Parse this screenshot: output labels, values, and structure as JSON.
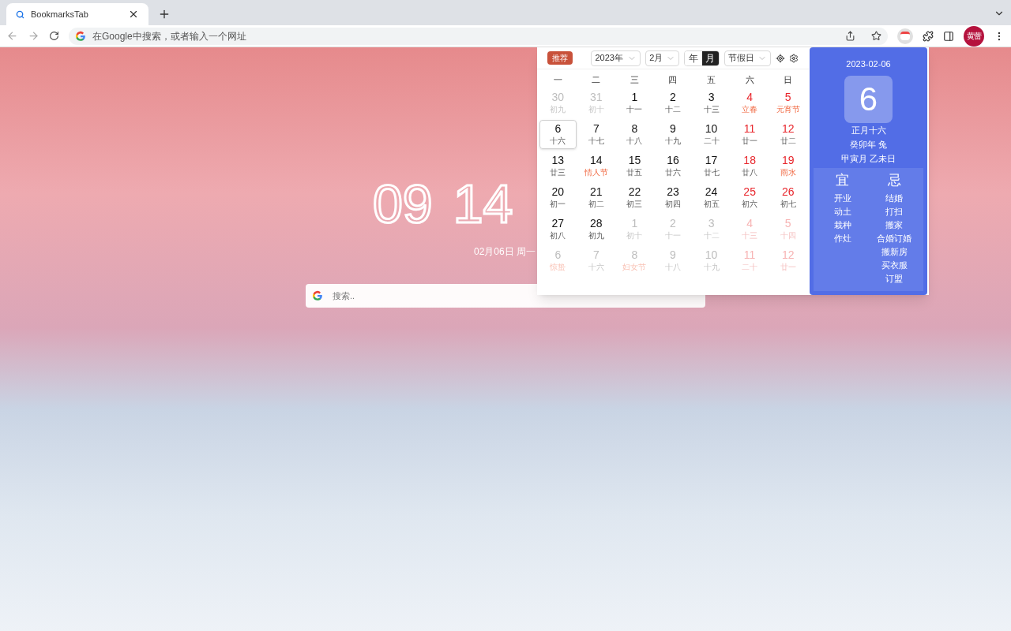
{
  "browser": {
    "tabs": [
      {
        "title": "BookmarksTab",
        "selected": true
      }
    ],
    "address": {
      "placeholder": "在Google中搜索，或者输入一个网址"
    },
    "profile": {
      "initials": "黄蕾"
    }
  },
  "clock": {
    "hours": "09",
    "minutes": "14",
    "date": "02月06日 周一"
  },
  "search": {
    "placeholder": "搜索.."
  },
  "calendar": {
    "badge": "推荐",
    "year_select": "2023年",
    "month_select": "2月",
    "view_toggle": [
      {
        "label": "年",
        "selected": false
      },
      {
        "label": "月",
        "selected": true
      }
    ],
    "filter_select": "节假日",
    "weekdays": [
      "一",
      "二",
      "三",
      "四",
      "五",
      "六",
      "日"
    ],
    "days": [
      {
        "day": "30",
        "sub": "初九",
        "muted": true,
        "red": false,
        "festival": false,
        "selected": false
      },
      {
        "day": "31",
        "sub": "初十",
        "muted": true,
        "red": false,
        "festival": false,
        "selected": false
      },
      {
        "day": "1",
        "sub": "十一",
        "muted": false,
        "red": false,
        "festival": false,
        "selected": false
      },
      {
        "day": "2",
        "sub": "十二",
        "muted": false,
        "red": false,
        "festival": false,
        "selected": false
      },
      {
        "day": "3",
        "sub": "十三",
        "muted": false,
        "red": false,
        "festival": false,
        "selected": false
      },
      {
        "day": "4",
        "sub": "立春",
        "muted": false,
        "red": true,
        "festival": true,
        "selected": false
      },
      {
        "day": "5",
        "sub": "元宵节",
        "muted": false,
        "red": true,
        "festival": true,
        "selected": false
      },
      {
        "day": "6",
        "sub": "十六",
        "muted": false,
        "red": false,
        "festival": false,
        "selected": true
      },
      {
        "day": "7",
        "sub": "十七",
        "muted": false,
        "red": false,
        "festival": false,
        "selected": false
      },
      {
        "day": "8",
        "sub": "十八",
        "muted": false,
        "red": false,
        "festival": false,
        "selected": false
      },
      {
        "day": "9",
        "sub": "十九",
        "muted": false,
        "red": false,
        "festival": false,
        "selected": false
      },
      {
        "day": "10",
        "sub": "二十",
        "muted": false,
        "red": false,
        "festival": false,
        "selected": false
      },
      {
        "day": "11",
        "sub": "廿一",
        "muted": false,
        "red": true,
        "festival": false,
        "selected": false
      },
      {
        "day": "12",
        "sub": "廿二",
        "muted": false,
        "red": true,
        "festival": false,
        "selected": false
      },
      {
        "day": "13",
        "sub": "廿三",
        "muted": false,
        "red": false,
        "festival": false,
        "selected": false
      },
      {
        "day": "14",
        "sub": "情人节",
        "muted": false,
        "red": false,
        "festival": true,
        "selected": false
      },
      {
        "day": "15",
        "sub": "廿五",
        "muted": false,
        "red": false,
        "festival": false,
        "selected": false
      },
      {
        "day": "16",
        "sub": "廿六",
        "muted": false,
        "red": false,
        "festival": false,
        "selected": false
      },
      {
        "day": "17",
        "sub": "廿七",
        "muted": false,
        "red": false,
        "festival": false,
        "selected": false
      },
      {
        "day": "18",
        "sub": "廿八",
        "muted": false,
        "red": true,
        "festival": false,
        "selected": false
      },
      {
        "day": "19",
        "sub": "雨水",
        "muted": false,
        "red": true,
        "festival": true,
        "selected": false
      },
      {
        "day": "20",
        "sub": "初一",
        "muted": false,
        "red": false,
        "festival": false,
        "selected": false
      },
      {
        "day": "21",
        "sub": "初二",
        "muted": false,
        "red": false,
        "festival": false,
        "selected": false
      },
      {
        "day": "22",
        "sub": "初三",
        "muted": false,
        "red": false,
        "festival": false,
        "selected": false
      },
      {
        "day": "23",
        "sub": "初四",
        "muted": false,
        "red": false,
        "festival": false,
        "selected": false
      },
      {
        "day": "24",
        "sub": "初五",
        "muted": false,
        "red": false,
        "festival": false,
        "selected": false
      },
      {
        "day": "25",
        "sub": "初六",
        "muted": false,
        "red": true,
        "festival": false,
        "selected": false
      },
      {
        "day": "26",
        "sub": "初七",
        "muted": false,
        "red": true,
        "festival": false,
        "selected": false
      },
      {
        "day": "27",
        "sub": "初八",
        "muted": false,
        "red": false,
        "festival": false,
        "selected": false
      },
      {
        "day": "28",
        "sub": "初九",
        "muted": false,
        "red": false,
        "festival": false,
        "selected": false
      },
      {
        "day": "1",
        "sub": "初十",
        "muted": true,
        "red": false,
        "festival": false,
        "selected": false
      },
      {
        "day": "2",
        "sub": "十一",
        "muted": true,
        "red": false,
        "festival": false,
        "selected": false
      },
      {
        "day": "3",
        "sub": "十二",
        "muted": true,
        "red": false,
        "festival": false,
        "selected": false
      },
      {
        "day": "4",
        "sub": "十三",
        "muted": true,
        "red": true,
        "festival": false,
        "selected": false
      },
      {
        "day": "5",
        "sub": "十四",
        "muted": true,
        "red": true,
        "festival": false,
        "selected": false
      },
      {
        "day": "6",
        "sub": "惊蛰",
        "muted": true,
        "red": false,
        "festival": true,
        "selected": false
      },
      {
        "day": "7",
        "sub": "十六",
        "muted": true,
        "red": false,
        "festival": false,
        "selected": false
      },
      {
        "day": "8",
        "sub": "妇女节",
        "muted": true,
        "red": false,
        "festival": true,
        "selected": false
      },
      {
        "day": "9",
        "sub": "十八",
        "muted": true,
        "red": false,
        "festival": false,
        "selected": false
      },
      {
        "day": "10",
        "sub": "十九",
        "muted": true,
        "red": false,
        "festival": false,
        "selected": false
      },
      {
        "day": "11",
        "sub": "二十",
        "muted": true,
        "red": true,
        "festival": false,
        "selected": false
      },
      {
        "day": "12",
        "sub": "廿一",
        "muted": true,
        "red": true,
        "festival": false,
        "selected": false
      }
    ]
  },
  "day_detail": {
    "date": "2023-02-06",
    "day": "6",
    "lunar_lines": [
      "正月十六",
      "癸卯年 兔",
      "甲寅月 乙未日"
    ],
    "yi": {
      "title": "宜",
      "items": [
        "开业",
        "动土",
        "栽种",
        "作灶"
      ]
    },
    "ji": {
      "title": "忌",
      "items": [
        "结婚",
        "打扫",
        "搬家",
        "合婚订婚",
        "搬新房",
        "买衣服",
        "订盟"
      ]
    }
  }
}
